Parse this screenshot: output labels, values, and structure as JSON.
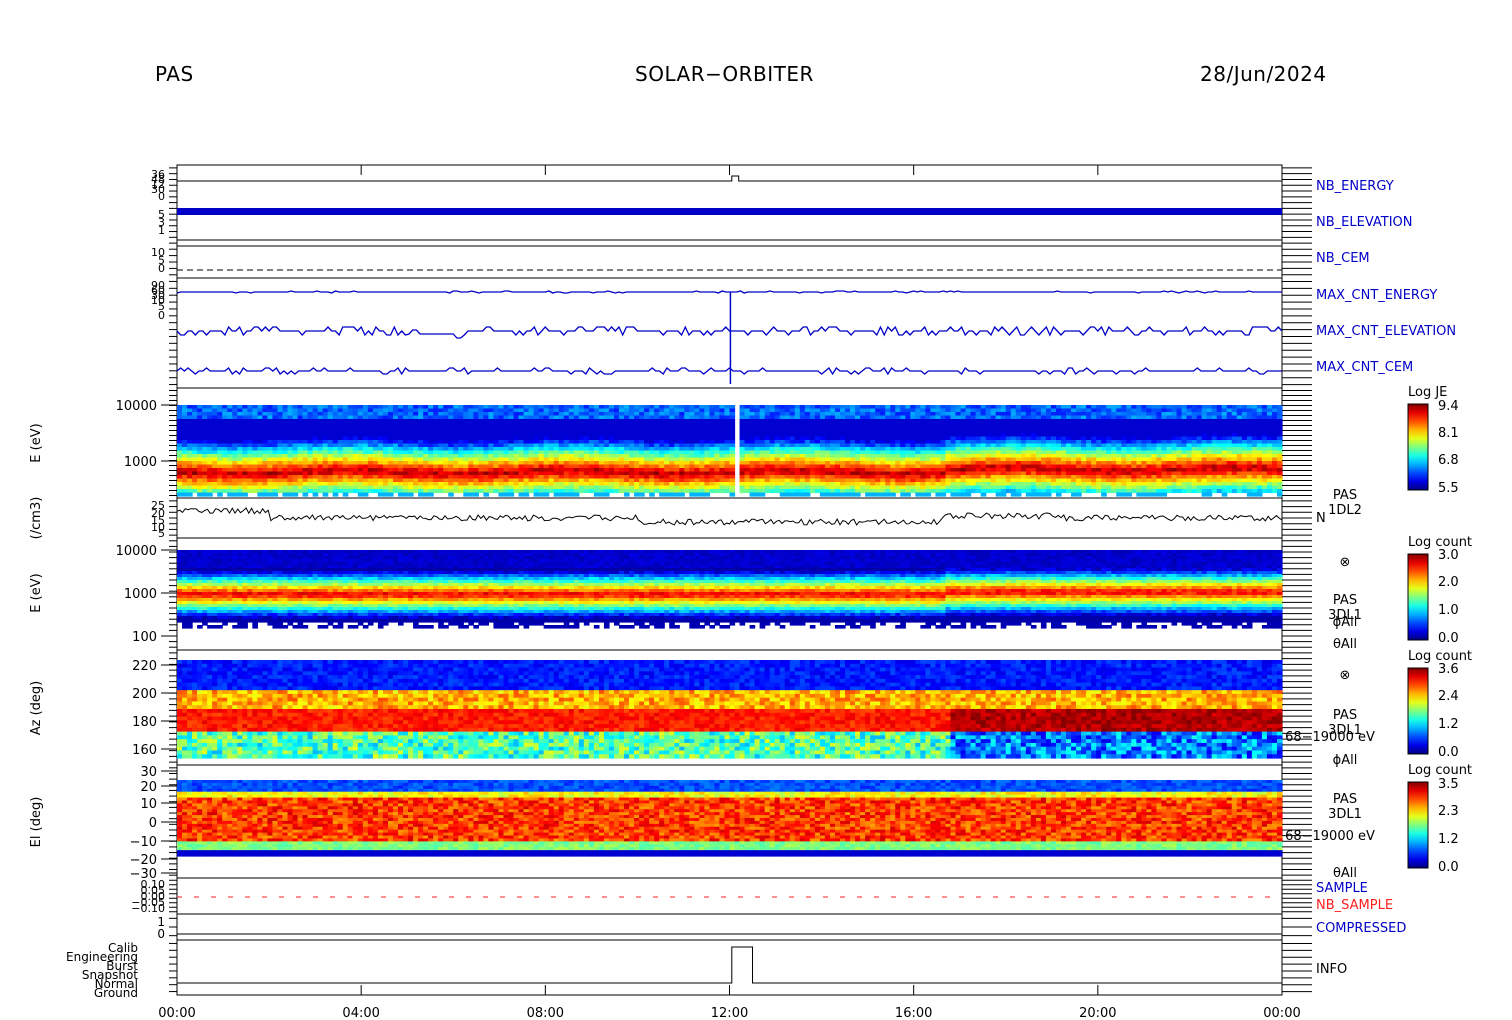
{
  "header": {
    "left": "PAS",
    "center": "SOLAR−ORBITER",
    "right": "28/Jun/2024"
  },
  "colors": {
    "blue_trace": "#0000c8",
    "red_trace": "#ff2020",
    "axis": "#000000"
  },
  "chart_data": {
    "type": "heatmap",
    "x_ticks": [
      "00:00",
      "04:00",
      "08:00",
      "12:00",
      "16:00",
      "20:00",
      "00:00"
    ],
    "x_range_hours": [
      0,
      24
    ],
    "panels": [
      {
        "id": "nb",
        "labels": [
          {
            "text": "NB_ENERGY",
            "color": "#0000c8"
          },
          {
            "text": "NB_ELEVATION",
            "color": "#0000c8"
          }
        ],
        "y_ticks": [
          "36",
          "48",
          "12",
          "30",
          "0",
          "5",
          "3",
          "1"
        ],
        "ylabel": ""
      },
      {
        "id": "nbcem",
        "labels": [
          {
            "text": "NB_CEM",
            "color": "#0000c8"
          }
        ],
        "y_ticks": [
          "10",
          "5",
          "0"
        ],
        "ylabel": ""
      },
      {
        "id": "maxcnt",
        "labels": [
          {
            "text": "MAX_CNT_ENERGY",
            "color": "#0000c8"
          },
          {
            "text": "MAX_CNT_ELEVATION",
            "color": "#0000c8"
          },
          {
            "text": "MAX_CNT_CEM",
            "color": "#0000c8"
          }
        ],
        "y_ticks": [
          "90",
          "60",
          "30",
          "10",
          "5",
          "0"
        ],
        "ylabel": ""
      },
      {
        "id": "je",
        "type": "spectrogram",
        "ylabel": "E (eV)",
        "y_ticks": [
          "10000",
          "1000"
        ],
        "y_scale": "log",
        "colorbar": {
          "title": "Log JE",
          "ticks": [
            "9.4",
            "8.1",
            "6.8",
            "5.5"
          ]
        }
      },
      {
        "id": "density",
        "type": "line",
        "ylabel": "(/cm3)",
        "y_ticks": [
          "25",
          "20",
          "15",
          "10",
          "5"
        ],
        "side_text": [
          "PAS",
          "1DL2",
          "N"
        ]
      },
      {
        "id": "3dl1e",
        "type": "spectrogram",
        "ylabel": "E (eV)",
        "y_ticks": [
          "10000",
          "1000",
          "100"
        ],
        "y_scale": "log",
        "colorbar": {
          "title": "Log count",
          "ticks": [
            "3.0",
            "2.0",
            "1.0",
            "0.0"
          ]
        },
        "side_text": [
          "⊗",
          "PAS",
          "3DL1",
          "ϕAll",
          "θAll"
        ]
      },
      {
        "id": "az",
        "type": "spectrogram",
        "ylabel": "Az (deg)",
        "y_ticks": [
          "220",
          "200",
          "180",
          "160"
        ],
        "colorbar": {
          "title": "Log count",
          "ticks": [
            "3.6",
            "2.4",
            "1.2",
            "0.0"
          ]
        },
        "side_text": [
          "⊗",
          "PAS",
          "3DL1",
          "68−19000 eV",
          "ϕAll"
        ]
      },
      {
        "id": "el",
        "type": "spectrogram",
        "ylabel": "El (deg)",
        "y_ticks": [
          "30",
          "20",
          "10",
          "0",
          "−10",
          "−20",
          "−30"
        ],
        "colorbar": {
          "title": "Log count",
          "ticks": [
            "3.5",
            "2.3",
            "1.2",
            "0.0"
          ]
        },
        "side_text": [
          "PAS",
          "3DL1",
          "68−19000 eV",
          "θAll"
        ]
      },
      {
        "id": "sample",
        "labels": [
          {
            "text": "SAMPLE",
            "color": "#0000c8"
          },
          {
            "text": "NB_SAMPLE",
            "color": "#ff2020"
          }
        ],
        "y_ticks": [
          "0.10",
          "0.05",
          "0.00",
          "−0.05",
          "−0.10"
        ],
        "ylabel": ""
      },
      {
        "id": "compressed",
        "labels": [
          {
            "text": "COMPRESSED",
            "color": "#0000c8"
          }
        ],
        "y_ticks": [
          "1",
          "0"
        ],
        "ylabel": ""
      },
      {
        "id": "info",
        "labels": [
          {
            "text": "INFO",
            "color": "#000000"
          }
        ],
        "y_ticks": [
          "Calib",
          "Engineering",
          "Burst",
          "Snapshot",
          "Normal",
          "Ground"
        ],
        "ylabel": ""
      }
    ]
  }
}
